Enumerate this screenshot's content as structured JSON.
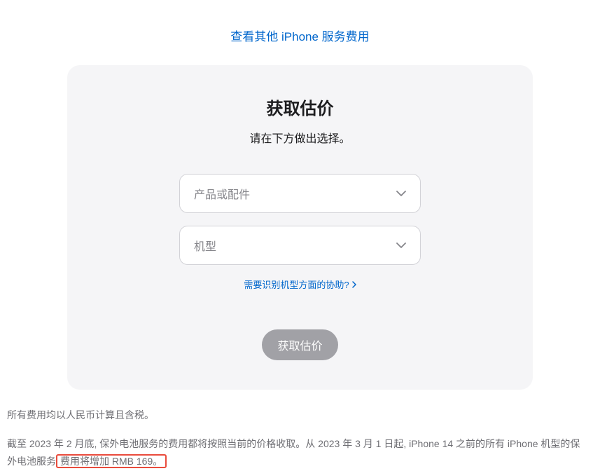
{
  "topLink": {
    "label": "查看其他 iPhone 服务费用"
  },
  "card": {
    "title": "获取估价",
    "subtitle": "请在下方做出选择。",
    "select1": {
      "placeholder": "产品或配件"
    },
    "select2": {
      "placeholder": "机型"
    },
    "helpLink": "需要识别机型方面的协助?",
    "submitLabel": "获取估价"
  },
  "footnote1": "所有费用均以人民币计算且含税。",
  "footnote2a": "截至 2023 年 2 月底, 保外电池服务的费用都将按照当前的价格收取。从 2023 年 3 月 1 日起, iPhone 14 之前的所有 iPhone 机型的保外电池服务",
  "footnote2b": "费用将增加 RMB 169。"
}
